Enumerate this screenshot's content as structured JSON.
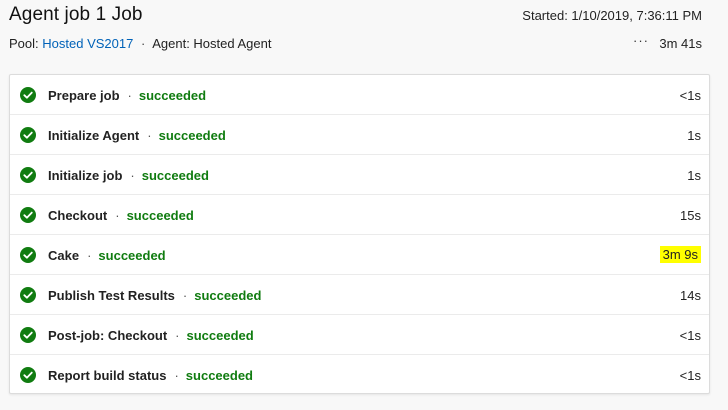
{
  "header": {
    "title": "Agent job 1 Job",
    "started": "Started: 1/10/2019, 7:36:11 PM",
    "pool_label": "Pool:",
    "pool_value": "Hosted VS2017",
    "separator": "·",
    "agent_label": "Agent: Hosted Agent",
    "more_glyph": "···",
    "total_duration": "3m 41s"
  },
  "steps": [
    {
      "name": "Prepare job",
      "status": "succeeded",
      "duration": "<1s",
      "highlighted": false
    },
    {
      "name": "Initialize Agent",
      "status": "succeeded",
      "duration": "1s",
      "highlighted": false
    },
    {
      "name": "Initialize job",
      "status": "succeeded",
      "duration": "1s",
      "highlighted": false
    },
    {
      "name": "Checkout",
      "status": "succeeded",
      "duration": "15s",
      "highlighted": false
    },
    {
      "name": "Cake",
      "status": "succeeded",
      "duration": "3m 9s",
      "highlighted": true
    },
    {
      "name": "Publish Test Results",
      "status": "succeeded",
      "duration": "14s",
      "highlighted": false
    },
    {
      "name": "Post-job: Checkout",
      "status": "succeeded",
      "duration": "<1s",
      "highlighted": false
    },
    {
      "name": "Report build status",
      "status": "succeeded",
      "duration": "<1s",
      "highlighted": false
    }
  ],
  "colors": {
    "success": "#107c10",
    "link": "#0062b8",
    "highlight": "#ffff00"
  },
  "icons": {
    "step_status": "check-circle-icon",
    "more": "more-icon"
  }
}
